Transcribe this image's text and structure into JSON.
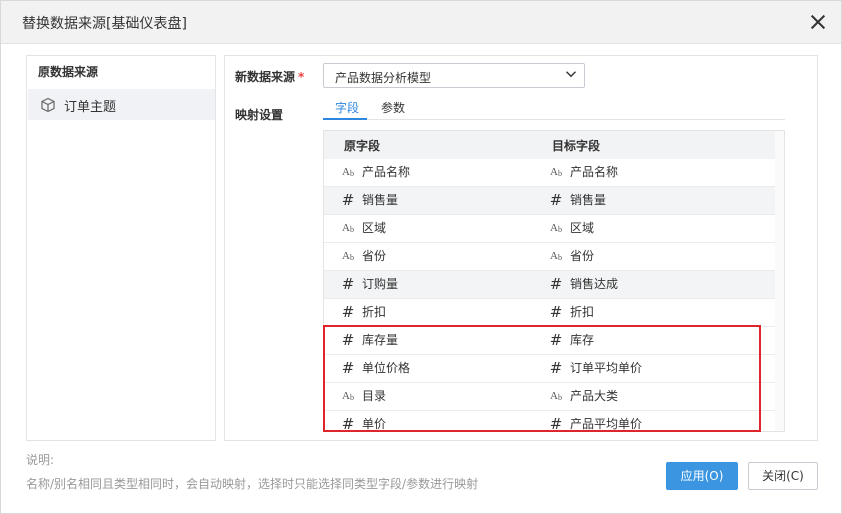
{
  "dialog": {
    "title": "替换数据来源[基础仪表盘]"
  },
  "left": {
    "header": "原数据来源",
    "item": "订单主题"
  },
  "right": {
    "datasource_label": "新数据来源",
    "required_mark": "*",
    "datasource_value": "产品数据分析模型",
    "mapping_label": "映射设置",
    "tabs": [
      "字段",
      "参数"
    ],
    "columns": [
      "原字段",
      "目标字段"
    ],
    "rows": [
      {
        "src_type": "text",
        "src": "产品名称",
        "dst_type": "text",
        "dst": "产品名称"
      },
      {
        "src_type": "number",
        "src": "销售量",
        "dst_type": "number",
        "dst": "销售量"
      },
      {
        "src_type": "text",
        "src": "区域",
        "dst_type": "text",
        "dst": "区域"
      },
      {
        "src_type": "text",
        "src": "省份",
        "dst_type": "text",
        "dst": "省份"
      },
      {
        "src_type": "number",
        "src": "订购量",
        "dst_type": "number",
        "dst": "销售达成"
      },
      {
        "src_type": "number",
        "src": "折扣",
        "dst_type": "number",
        "dst": "折扣"
      },
      {
        "src_type": "number",
        "src": "库存量",
        "dst_type": "number",
        "dst": "库存"
      },
      {
        "src_type": "number",
        "src": "单位价格",
        "dst_type": "number",
        "dst": "订单平均单价"
      },
      {
        "src_type": "text",
        "src": "目录",
        "dst_type": "text",
        "dst": "产品大类"
      },
      {
        "src_type": "number",
        "src": "单价",
        "dst_type": "number",
        "dst": "产品平均单价"
      }
    ]
  },
  "footer": {
    "note_title": "说明:",
    "note_text": "名称/别名相同且类型相同时，会自动映射，选择时只能选择同类型字段/参数进行映射",
    "apply": "应用(O)",
    "close": "关闭(C)"
  },
  "colors": {
    "accent": "#3b95e0",
    "highlight_border": "#e0252a"
  }
}
